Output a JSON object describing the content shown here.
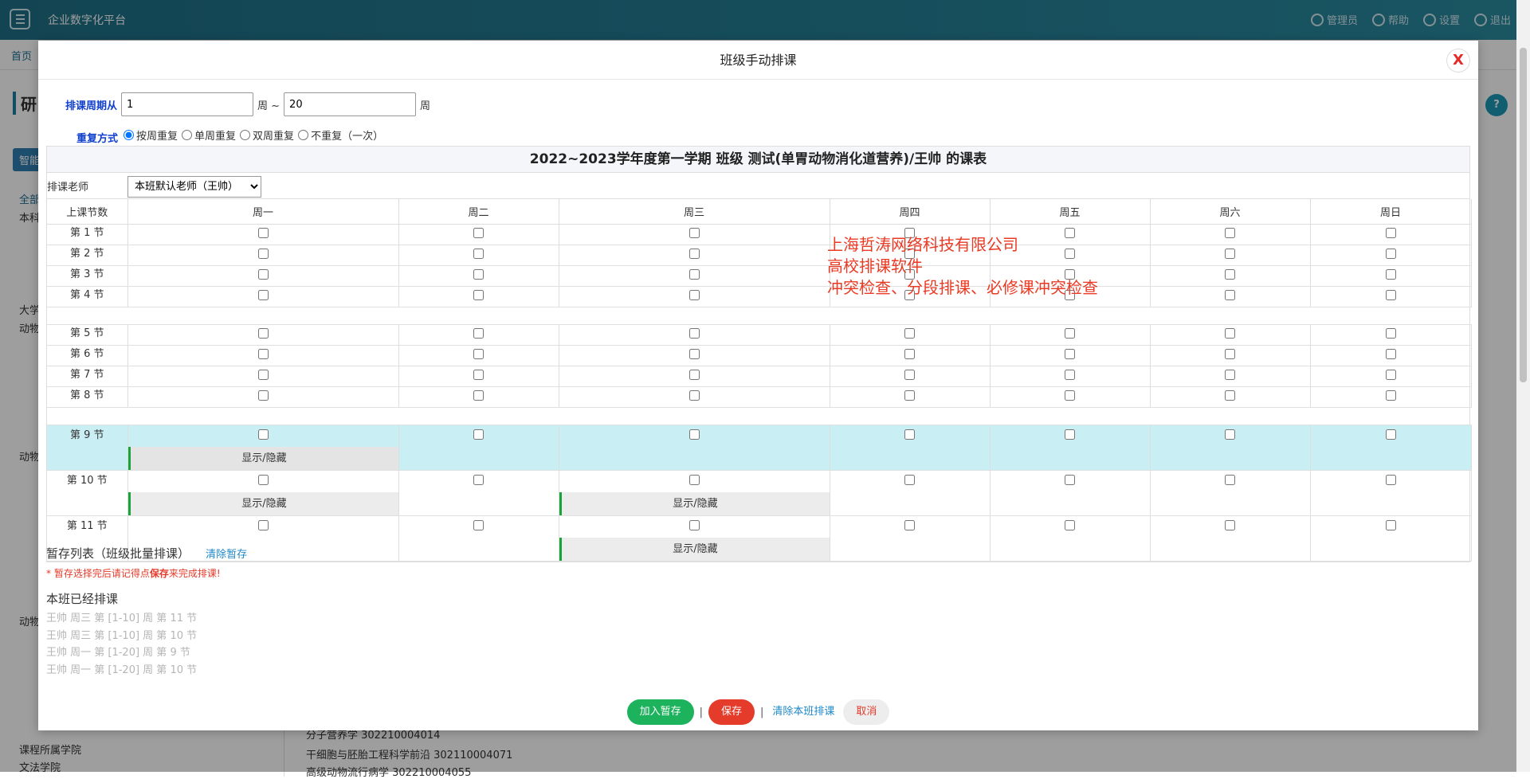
{
  "app": {
    "title": "企业数字化平台",
    "top_right": [
      "管理员",
      "帮助",
      "设置",
      "退出"
    ]
  },
  "background": {
    "breadcrumb_home": "首页",
    "page_title": "研",
    "tab": "智能",
    "left_items": [
      "全部",
      "本科",
      "大学",
      "动物",
      "动物",
      "动物",
      "课程所属学院",
      "文法学院"
    ],
    "col2_items": [
      "分子营养学 302210004014",
      "干细胞与胚胎工程科学前沿 302110004071",
      "高级动物流行病学 302210004055"
    ],
    "help": "?"
  },
  "dialog": {
    "title": "班级手动排课",
    "close_label": "X",
    "period_label": "排课周期从",
    "week_from": "1",
    "week_to": "20",
    "week_sep": "周 ~",
    "week_unit": "周",
    "repeat_label": "重复方式",
    "repeat_options": [
      "按周重复",
      "单周重复",
      "双周重复",
      "不重复（一次）"
    ],
    "table_title": "2022~2023学年度第一学期 班级 测试(单胃动物消化道营养)/王帅 的课表",
    "teacher_label": "排课老师",
    "teacher_selected": "本班默认老师（王帅）",
    "columns": [
      "上课节数",
      "周一",
      "周二",
      "周三",
      "周四",
      "周五",
      "周六",
      "周日"
    ],
    "sections": [
      "第 1 节",
      "第 2 节",
      "第 3 节",
      "第 4 节",
      "第 5 节",
      "第 6 节",
      "第 7 节",
      "第 8 节",
      "第 9 节",
      "第 10 节",
      "第 11 节"
    ],
    "show_hide": "显示/隐藏",
    "watermark": [
      "上海哲涛网络科技有限公司",
      "高校排课软件",
      "冲突检查、分段排课、必修课冲突检查"
    ],
    "staging_title": "暂存列表（班级批量排课）",
    "staging_clear": "清除暂存",
    "staging_note_1": "* 暂存选择完后请记得点",
    "staging_note_save": "保存",
    "staging_note_2": "来完成排课!",
    "scheduled_title": "本班已经排课",
    "scheduled_items": [
      "王帅 周三 第 [1-10] 周 第 11 节",
      "王帅 周三 第 [1-10] 周 第 10 节",
      "王帅 周一 第 [1-20] 周 第 9 节",
      "王帅 周一 第 [1-20] 周 第 10 节"
    ],
    "actions": {
      "add_staging": "加入暂存",
      "save": "保存",
      "clear_class": "清除本班排课",
      "cancel": "取消"
    }
  }
}
